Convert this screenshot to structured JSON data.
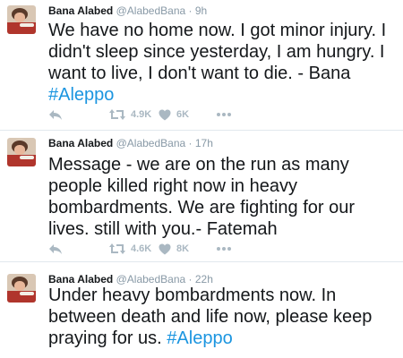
{
  "colors": {
    "hashtag": "#1b95e0",
    "meta": "#8899a6",
    "icon": "#aab8c2",
    "divider": "#e1e8ed"
  },
  "tweets": [
    {
      "name": "Bana Alabed",
      "handle": "@AlabedBana",
      "separator": "·",
      "time": "9h",
      "text": "We have no home now. I got minor injury. I didn't sleep since yesterday, I am hungry. I want to live, I don't want to die. - Bana ",
      "hashtag": "#Aleppo",
      "retweets": "4.9K",
      "likes": "6K",
      "icons": [
        "reply-icon",
        "retweet-icon",
        "heart-icon",
        "more-icon"
      ]
    },
    {
      "name": "Bana Alabed",
      "handle": "@AlabedBana",
      "separator": "·",
      "time": "17h",
      "text": "Message - we are on the run as many people killed right now in heavy bombardments. We are fighting for our lives. still with you.- Fatemah",
      "hashtag": "",
      "retweets": "4.6K",
      "likes": "8K",
      "icons": [
        "reply-icon",
        "retweet-icon",
        "heart-icon",
        "more-icon"
      ]
    },
    {
      "name": "Bana Alabed",
      "handle": "@AlabedBana",
      "separator": "·",
      "time": "22h",
      "text": "Under heavy bombardments now. In between death and life now, please keep praying for us. ",
      "hashtag": "#Aleppo"
    }
  ]
}
